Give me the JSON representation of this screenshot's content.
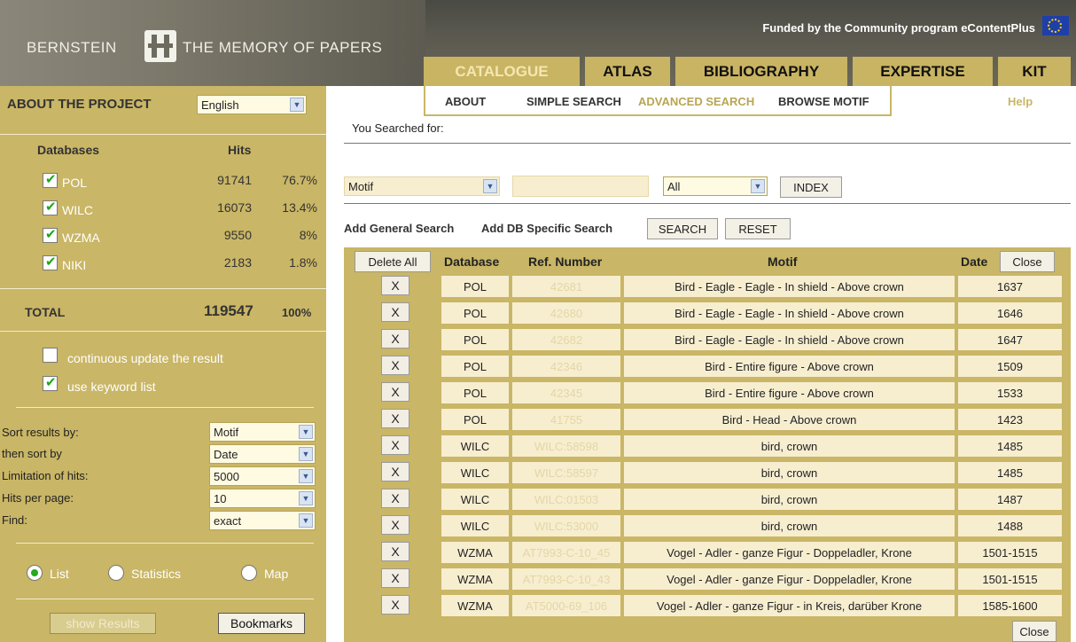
{
  "header": {
    "logo_left": "BERNSTEIN",
    "logo_right": "THE MEMORY OF PAPERS",
    "funded": "Funded by the Community program eContentPlus",
    "tabs": [
      {
        "label": "CATALOGUE",
        "active": true
      },
      {
        "label": "ATLAS",
        "active": false
      },
      {
        "label": "BIBLIOGRAPHY",
        "active": false
      },
      {
        "label": "EXPERTISE",
        "active": false
      },
      {
        "label": "KIT",
        "active": false
      }
    ]
  },
  "subnav": {
    "items": [
      "ABOUT",
      "SIMPLE SEARCH",
      "ADVANCED SEARCH",
      "BROWSE MOTIF"
    ],
    "active_index": 2,
    "help": "Help"
  },
  "sidebar": {
    "title": "ABOUT THE PROJECT",
    "language": "English",
    "db_header": "Databases",
    "hits_header": "Hits",
    "databases": [
      {
        "name": "POL",
        "hits": "91741",
        "pct": "76.7%",
        "checked": true
      },
      {
        "name": "WILC",
        "hits": "16073",
        "pct": "13.4%",
        "checked": true
      },
      {
        "name": "WZMA",
        "hits": "9550",
        "pct": "8%",
        "checked": true
      },
      {
        "name": "NIKI",
        "hits": "2183",
        "pct": "1.8%",
        "checked": true
      }
    ],
    "total_label": "TOTAL",
    "total_hits": "119547",
    "total_pct": "100%",
    "options": [
      {
        "label": "continuous update the result",
        "checked": false
      },
      {
        "label": "use keyword list",
        "checked": true
      }
    ],
    "sort": {
      "sort_by_label": "Sort results by:",
      "sort_by": "Motif",
      "then_by_label": "then sort by",
      "then_by": "Date",
      "limit_label": "Limitation of hits:",
      "limit": "5000",
      "per_page_label": "Hits per page:",
      "per_page": "10",
      "find_label": "Find:",
      "find": "exact"
    },
    "view": {
      "list": "List",
      "statistics": "Statistics",
      "map": "Map",
      "selected": "List"
    },
    "show_results": "show Results",
    "bookmarks": "Bookmarks"
  },
  "search": {
    "searched_for": "You Searched for:",
    "field": "Motif",
    "value": "",
    "scope": "All",
    "index_btn": "INDEX",
    "add_general": "Add General Search",
    "add_db": "Add DB Specific Search",
    "search_btn": "SEARCH",
    "reset_btn": "RESET"
  },
  "results": {
    "delete_all": "Delete All",
    "close": "Close",
    "columns": [
      "Database",
      "Ref. Number",
      "Motif",
      "Date"
    ],
    "remove_label": "X",
    "rows": [
      {
        "db": "POL",
        "ref": "42681",
        "motif": "Bird - Eagle - Eagle - In shield - Above crown",
        "date": "1637"
      },
      {
        "db": "POL",
        "ref": "42680",
        "motif": "Bird - Eagle - Eagle - In shield - Above crown",
        "date": "1646"
      },
      {
        "db": "POL",
        "ref": "42682",
        "motif": "Bird - Eagle - Eagle - In shield - Above crown",
        "date": "1647"
      },
      {
        "db": "POL",
        "ref": "42346",
        "motif": "Bird - Entire figure - Above crown",
        "date": "1509"
      },
      {
        "db": "POL",
        "ref": "42345",
        "motif": "Bird - Entire figure - Above crown",
        "date": "1533"
      },
      {
        "db": "POL",
        "ref": "41755",
        "motif": "Bird - Head - Above crown",
        "date": "1423"
      },
      {
        "db": "WILC",
        "ref": "WILC:58598",
        "motif": "bird, crown",
        "date": "1485"
      },
      {
        "db": "WILC",
        "ref": "WILC:58597",
        "motif": "bird, crown",
        "date": "1485"
      },
      {
        "db": "WILC",
        "ref": "WILC:01503",
        "motif": "bird, crown",
        "date": "1487"
      },
      {
        "db": "WILC",
        "ref": "WILC:53000",
        "motif": "bird, crown",
        "date": "1488"
      },
      {
        "db": "WZMA",
        "ref": "AT7993-C-10_45",
        "motif": "Vogel - Adler - ganze Figur - Doppeladler, Krone",
        "date": "1501-1515"
      },
      {
        "db": "WZMA",
        "ref": "AT7993-C-10_43",
        "motif": "Vogel - Adler - ganze Figur - Doppeladler, Krone",
        "date": "1501-1515"
      },
      {
        "db": "WZMA",
        "ref": "AT5000-69_106",
        "motif": "Vogel - Adler - ganze Figur - in Kreis, darüber Krone",
        "date": "1585-1600"
      }
    ]
  }
}
